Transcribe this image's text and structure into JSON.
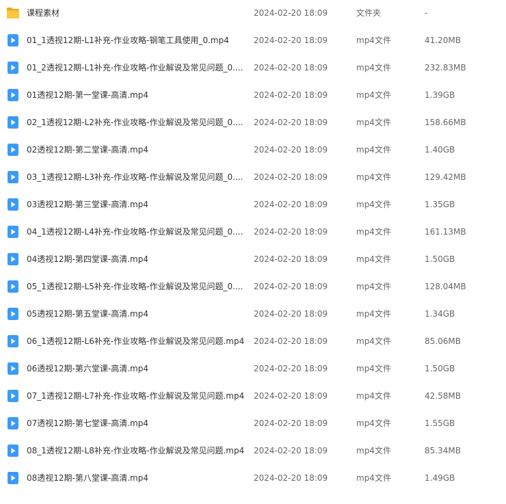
{
  "colors": {
    "folder": "#FFC63B",
    "video": "#3B9AF5",
    "text": "#333333",
    "muted": "#666666"
  },
  "rows": [
    {
      "icon": "folder-icon",
      "name": "课程素材",
      "date": "2024-02-20 18:09",
      "type": "文件夹",
      "size": "-"
    },
    {
      "icon": "video-file-icon",
      "name": "01_1透视12期-L1补充-作业攻略-钢笔工具使用_0.mp4",
      "date": "2024-02-20 18:09",
      "type": "mp4文件",
      "size": "41.20MB"
    },
    {
      "icon": "video-file-icon",
      "name": "01_2透视12期-L1补充-作业攻略-作业解说及常见问题_0....",
      "date": "2024-02-20 18:09",
      "type": "mp4文件",
      "size": "232.83MB"
    },
    {
      "icon": "video-file-icon",
      "name": "01透视12期-第一堂课-高清.mp4",
      "date": "2024-02-20 18:09",
      "type": "mp4文件",
      "size": "1.39GB"
    },
    {
      "icon": "video-file-icon",
      "name": "02_1透视12期-L2补充-作业攻略-作业解说及常见问题_0....",
      "date": "2024-02-20 18:09",
      "type": "mp4文件",
      "size": "158.66MB"
    },
    {
      "icon": "video-file-icon",
      "name": "02透视12期-第二堂课-高清.mp4",
      "date": "2024-02-20 18:09",
      "type": "mp4文件",
      "size": "1.40GB"
    },
    {
      "icon": "video-file-icon",
      "name": "03_1透视12期-L3补充-作业攻略-作业解说及常见问题_0....",
      "date": "2024-02-20 18:09",
      "type": "mp4文件",
      "size": "129.42MB"
    },
    {
      "icon": "video-file-icon",
      "name": "03透视12期-第三堂课-高清.mp4",
      "date": "2024-02-20 18:09",
      "type": "mp4文件",
      "size": "1.35GB"
    },
    {
      "icon": "video-file-icon",
      "name": "04_1透视12期-L4补充-作业攻略-作业解说及常见问题_0....",
      "date": "2024-02-20 18:09",
      "type": "mp4文件",
      "size": "161.13MB"
    },
    {
      "icon": "video-file-icon",
      "name": "04透视12期-第四堂课-高清.mp4",
      "date": "2024-02-20 18:09",
      "type": "mp4文件",
      "size": "1.50GB"
    },
    {
      "icon": "video-file-icon",
      "name": "05_1透视12期-L5补充-作业攻略-作业解说及常见问题_0....",
      "date": "2024-02-20 18:09",
      "type": "mp4文件",
      "size": "128.04MB"
    },
    {
      "icon": "video-file-icon",
      "name": "05透视12期-第五堂课-高清.mp4",
      "date": "2024-02-20 18:09",
      "type": "mp4文件",
      "size": "1.34GB"
    },
    {
      "icon": "video-file-icon",
      "name": "06_1透视12期-L6补充-作业攻略-作业解说及常见问题.mp4",
      "date": "2024-02-20 18:09",
      "type": "mp4文件",
      "size": "85.06MB"
    },
    {
      "icon": "video-file-icon",
      "name": "06透视12期-第六堂课-高清.mp4",
      "date": "2024-02-20 18:09",
      "type": "mp4文件",
      "size": "1.50GB"
    },
    {
      "icon": "video-file-icon",
      "name": "07_1透视12期-L7补充-作业攻略-作业解说及常见问题.mp4",
      "date": "2024-02-20 18:09",
      "type": "mp4文件",
      "size": "42.58MB"
    },
    {
      "icon": "video-file-icon",
      "name": "07透视12期-第七堂课-高清.mp4",
      "date": "2024-02-20 18:09",
      "type": "mp4文件",
      "size": "1.55GB"
    },
    {
      "icon": "video-file-icon",
      "name": "08_1透视12期-L8补充-作业攻略-作业解说及常见问题.mp4",
      "date": "2024-02-20 18:09",
      "type": "mp4文件",
      "size": "85.34MB"
    },
    {
      "icon": "video-file-icon",
      "name": "08透视12期-第八堂课-高清.mp4",
      "date": "2024-02-20 18:09",
      "type": "mp4文件",
      "size": "1.49GB"
    }
  ]
}
